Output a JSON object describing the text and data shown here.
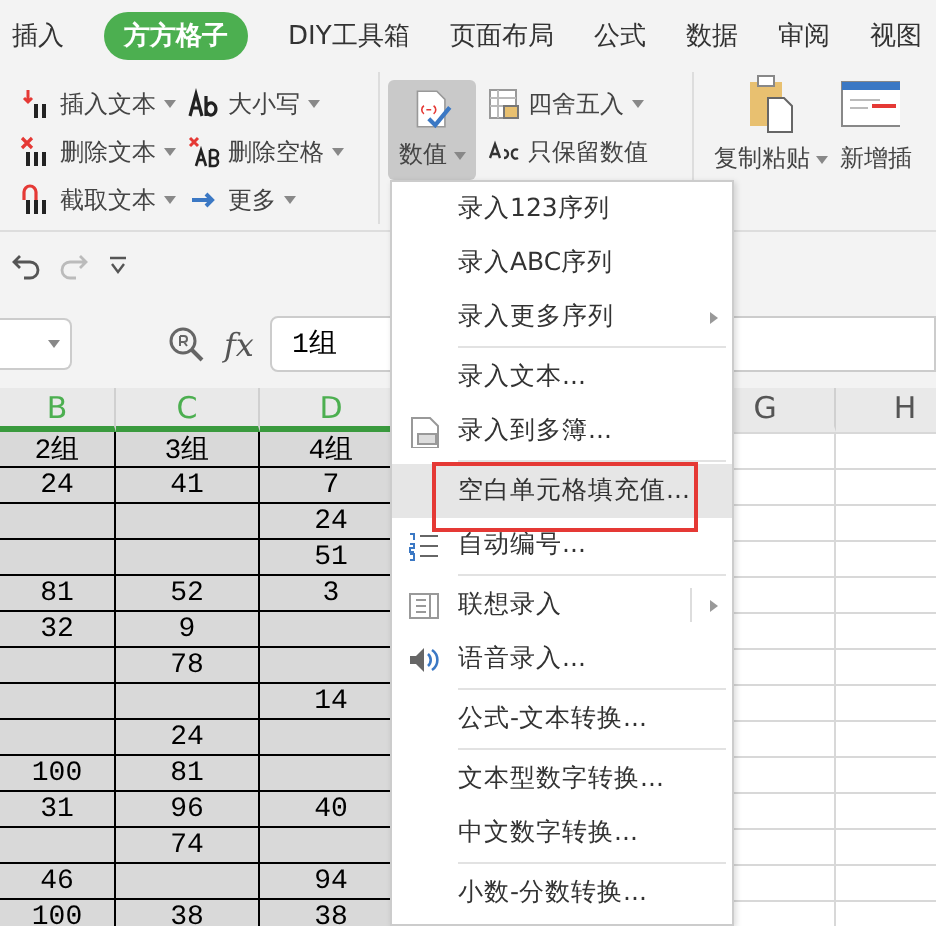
{
  "tabs": [
    {
      "label": "插入",
      "selected": false
    },
    {
      "label": "方方格子",
      "selected": true
    },
    {
      "label": "DIY工具箱",
      "selected": false
    },
    {
      "label": "页面布局",
      "selected": false
    },
    {
      "label": "公式",
      "selected": false
    },
    {
      "label": "数据",
      "selected": false
    },
    {
      "label": "审阅",
      "selected": false
    },
    {
      "label": "视图",
      "selected": false
    }
  ],
  "ribbon": {
    "text_tools": [
      [
        {
          "label": "插入文本",
          "dropdown": true
        },
        {
          "label": "删除文本",
          "dropdown": true
        },
        {
          "label": "截取文本",
          "dropdown": true
        }
      ],
      [
        {
          "label": "大小写",
          "dropdown": true
        },
        {
          "label": "删除空格",
          "dropdown": true
        },
        {
          "label": "更多",
          "dropdown": true
        }
      ]
    ],
    "value_button": {
      "label": "数值",
      "dropdown": true,
      "pressed": true
    },
    "number_tools": [
      {
        "label": "四舍五入",
        "dropdown": true
      },
      {
        "label": "只保留数值",
        "dropdown": false
      }
    ],
    "paste_button": {
      "label": "复制粘贴",
      "dropdown": true
    },
    "insert_button": {
      "label": "新增插"
    }
  },
  "formula_bar": {
    "function_label": "fx",
    "value": "1组"
  },
  "sheet": {
    "columns": [
      {
        "label": "B",
        "selected": true
      },
      {
        "label": "C",
        "selected": true
      },
      {
        "label": "D",
        "selected": true
      }
    ],
    "far_columns": [
      {
        "label": "G",
        "selected": false
      },
      {
        "label": "H",
        "selected": false
      }
    ],
    "rows": [
      [
        "2组",
        "3组",
        "4组"
      ],
      [
        "24",
        "41",
        "7"
      ],
      [
        "",
        "",
        "24"
      ],
      [
        "",
        "",
        "51"
      ],
      [
        "81",
        "52",
        "3"
      ],
      [
        "32",
        "9",
        ""
      ],
      [
        "",
        "78",
        ""
      ],
      [
        "",
        "",
        "14"
      ],
      [
        "",
        "24",
        ""
      ],
      [
        "100",
        "81",
        ""
      ],
      [
        "31",
        "96",
        "40"
      ],
      [
        "",
        "74",
        ""
      ],
      [
        "46",
        "",
        "94"
      ],
      [
        "100",
        "38",
        "38"
      ]
    ]
  },
  "menu": {
    "items": [
      {
        "kind": "item",
        "label": "录入123序列",
        "submenu": false,
        "hovered": false,
        "outlined": false
      },
      {
        "kind": "item",
        "label": "录入ABC序列",
        "submenu": false,
        "hovered": false,
        "outlined": false
      },
      {
        "kind": "item",
        "label": "录入更多序列",
        "submenu": true,
        "hovered": false,
        "outlined": false
      },
      {
        "kind": "separator"
      },
      {
        "kind": "item",
        "label": "录入文本...",
        "submenu": false,
        "hovered": false,
        "outlined": false
      },
      {
        "kind": "item",
        "label": "录入到多簿...",
        "submenu": false,
        "hovered": false,
        "outlined": false
      },
      {
        "kind": "separator"
      },
      {
        "kind": "item",
        "label": "空白单元格填充值...",
        "submenu": false,
        "hovered": true,
        "outlined": true
      },
      {
        "kind": "item",
        "label": "自动编号...",
        "submenu": false,
        "hovered": false,
        "outlined": false
      },
      {
        "kind": "separator"
      },
      {
        "kind": "item",
        "label": "联想录入",
        "submenu": true,
        "hovered": false,
        "outlined": false
      },
      {
        "kind": "item",
        "label": "语音录入...",
        "submenu": false,
        "hovered": false,
        "outlined": false
      },
      {
        "kind": "separator"
      },
      {
        "kind": "item",
        "label": "公式-文本转换...",
        "submenu": false,
        "hovered": false,
        "outlined": false
      },
      {
        "kind": "separator"
      },
      {
        "kind": "item",
        "label": "文本型数字转换...",
        "submenu": false,
        "hovered": false,
        "outlined": false
      },
      {
        "kind": "item",
        "label": "中文数字转换...",
        "submenu": false,
        "hovered": false,
        "outlined": false
      },
      {
        "kind": "separator"
      },
      {
        "kind": "item",
        "label": "小数-分数转换...",
        "submenu": false,
        "hovered": false,
        "outlined": false
      }
    ]
  }
}
